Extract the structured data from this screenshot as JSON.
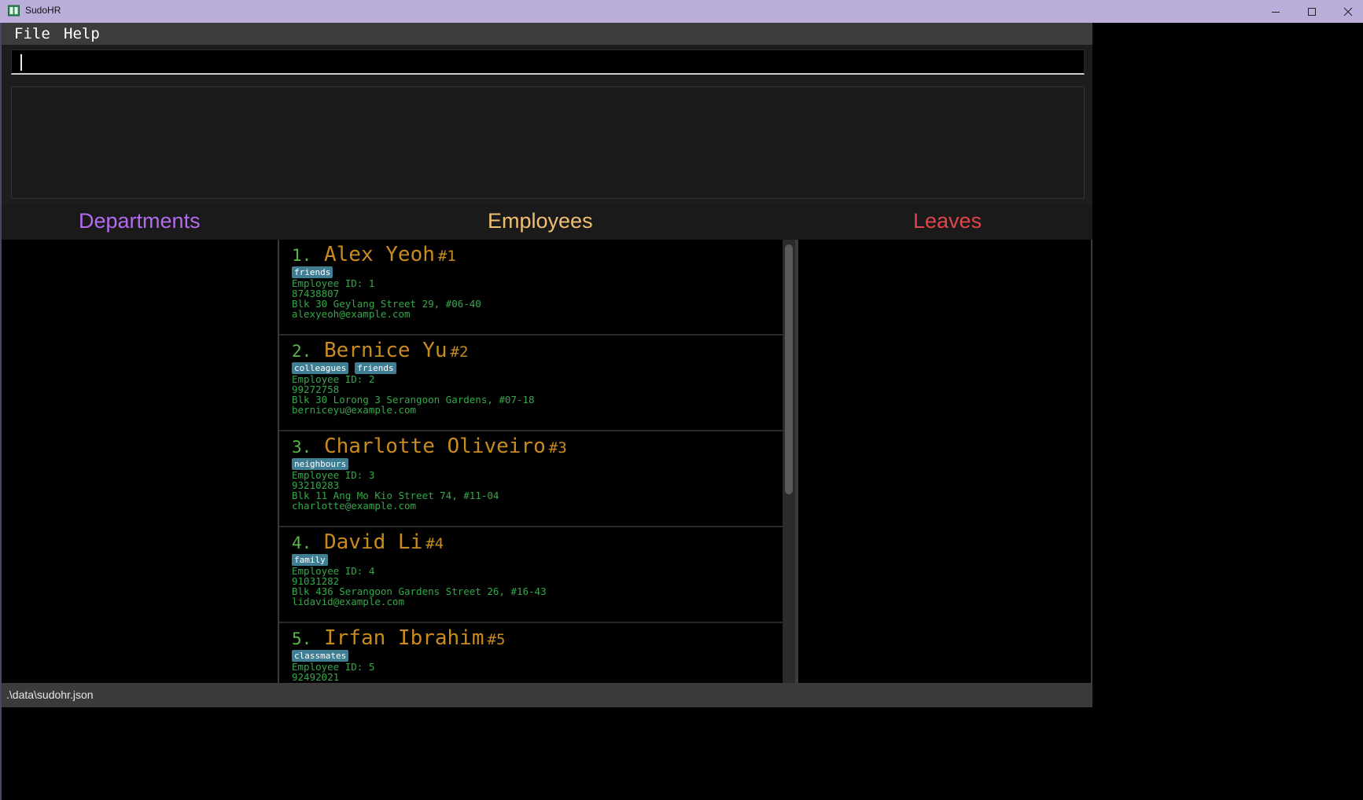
{
  "window": {
    "title": "SudoHR"
  },
  "menu": {
    "file": "File",
    "help": "Help"
  },
  "command": {
    "value": ""
  },
  "panels": {
    "departments": "Departments",
    "employees": "Employees",
    "leaves": "Leaves"
  },
  "colors": {
    "departments_title": "#b36bf0",
    "employees_title": "#f0c070",
    "leaves_title": "#e0454a",
    "name": "#c98b1e",
    "field": "#35a84a",
    "tag": "#3f7e93"
  },
  "employees": [
    {
      "index": "1.",
      "name": "Alex Yeoh",
      "hash": "#1",
      "tags": [
        "friends"
      ],
      "id": "Employee ID: 1",
      "phone": "87438807",
      "address": "Blk 30 Geylang Street 29, #06-40",
      "email": "alexyeoh@example.com"
    },
    {
      "index": "2.",
      "name": "Bernice Yu",
      "hash": "#2",
      "tags": [
        "colleagues",
        "friends"
      ],
      "id": "Employee ID: 2",
      "phone": "99272758",
      "address": "Blk 30 Lorong 3 Serangoon Gardens, #07-18",
      "email": "berniceyu@example.com"
    },
    {
      "index": "3.",
      "name": "Charlotte Oliveiro",
      "hash": "#3",
      "tags": [
        "neighbours"
      ],
      "id": "Employee ID: 3",
      "phone": "93210283",
      "address": "Blk 11 Ang Mo Kio Street 74, #11-04",
      "email": "charlotte@example.com"
    },
    {
      "index": "4.",
      "name": "David Li",
      "hash": "#4",
      "tags": [
        "family"
      ],
      "id": "Employee ID: 4",
      "phone": "91031282",
      "address": "Blk 436 Serangoon Gardens Street 26, #16-43",
      "email": "lidavid@example.com"
    },
    {
      "index": "5.",
      "name": "Irfan Ibrahim",
      "hash": "#5",
      "tags": [
        "classmates"
      ],
      "id": "Employee ID: 5",
      "phone": "92492021",
      "address": "",
      "email": ""
    }
  ],
  "status": {
    "path": ".\\data\\sudohr.json"
  },
  "icons": {
    "app": "app-book-icon",
    "minimize": "minimize-icon",
    "maximize": "maximize-icon",
    "close": "close-icon"
  }
}
